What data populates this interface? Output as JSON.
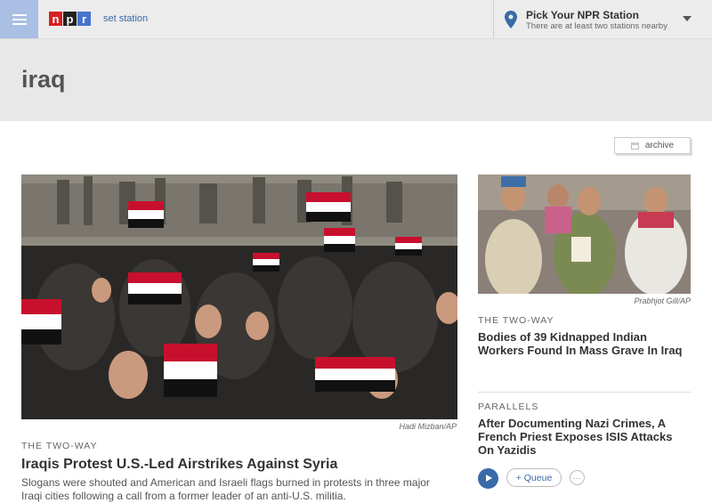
{
  "header": {
    "logo_letters": [
      "n",
      "p",
      "r"
    ],
    "logo_colors": [
      "#d62021",
      "#222222",
      "#4774cc"
    ],
    "set_station_label": "set station",
    "station_picker": {
      "title": "Pick Your NPR Station",
      "subtitle": "There are at least two stations nearby"
    }
  },
  "page": {
    "title": "iraq",
    "archive_label": "archive"
  },
  "main_story": {
    "image_credit": "Hadi Mizban/AP",
    "kicker": "The Two-Way",
    "headline": "Iraqis Protest U.S.-Led Airstrikes Against Syria",
    "teaser": "Slogans were shouted and American and Israeli flags burned in protests in three major Iraqi cities following a call from a former leader of an anti-U.S. militia."
  },
  "side_stories": [
    {
      "image_credit": "Prabhjot Gill/AP",
      "kicker": "The Two-Way",
      "headline": "Bodies of 39 Kidnapped Indian Workers Found In Mass Grave In Iraq"
    },
    {
      "kicker": "Parallels",
      "headline": "After Documenting Nazi Crimes, A French Priest Exposes ISIS Attacks On Yazidis",
      "queue_label": "+ Queue",
      "more_label": "···"
    }
  ],
  "colors": {
    "accent": "#3a6aa8",
    "menu_bg": "#a9bfe3"
  }
}
